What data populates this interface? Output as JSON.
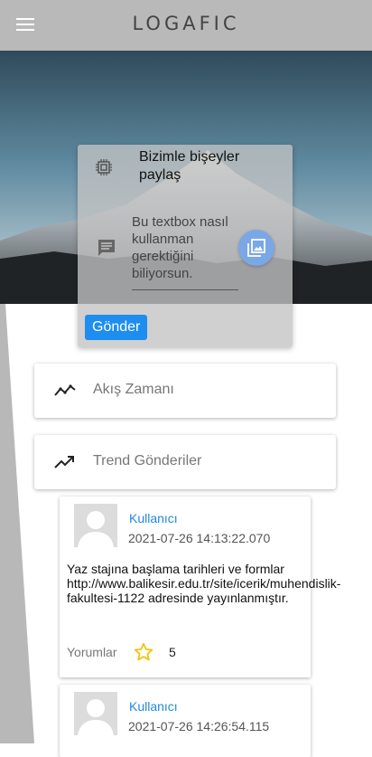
{
  "appbar": {
    "title": "LOGAFIC",
    "menu_icon": "menu-icon"
  },
  "composer": {
    "title": "Bizimle bişeyler paylaş",
    "placeholder": "Bu textbox nasıl kullanman gerektiğini biliyorsun.",
    "send_label": "Gönder",
    "icons": [
      "cpu-icon",
      "comment-icon",
      "image-icon"
    ],
    "send_color": "#1e8df0"
  },
  "nav": [
    {
      "label": "Akış Zamanı",
      "icon": "timeline-icon"
    },
    {
      "label": "Trend Gönderiler",
      "icon": "trending-up-icon"
    }
  ],
  "feed": [
    {
      "user": "Kullanıcı",
      "timestamp": "2021-07-26 14:13:22.070",
      "body": "Yaz stajına başlama tarihleri ve formlar http://www.balikesir.edu.tr/site/icerik/muhendislik-fakultesi-1122 adresinde yayınlanmıştır.",
      "comments_label": "Yorumlar",
      "stars": "5"
    },
    {
      "user": "Kullanıcı",
      "timestamp": "2021-07-26 14:26:54.115"
    }
  ],
  "colors": {
    "appbar": "#b9b9b9",
    "accent": "#1e88e5",
    "star": "#f2c40f"
  }
}
